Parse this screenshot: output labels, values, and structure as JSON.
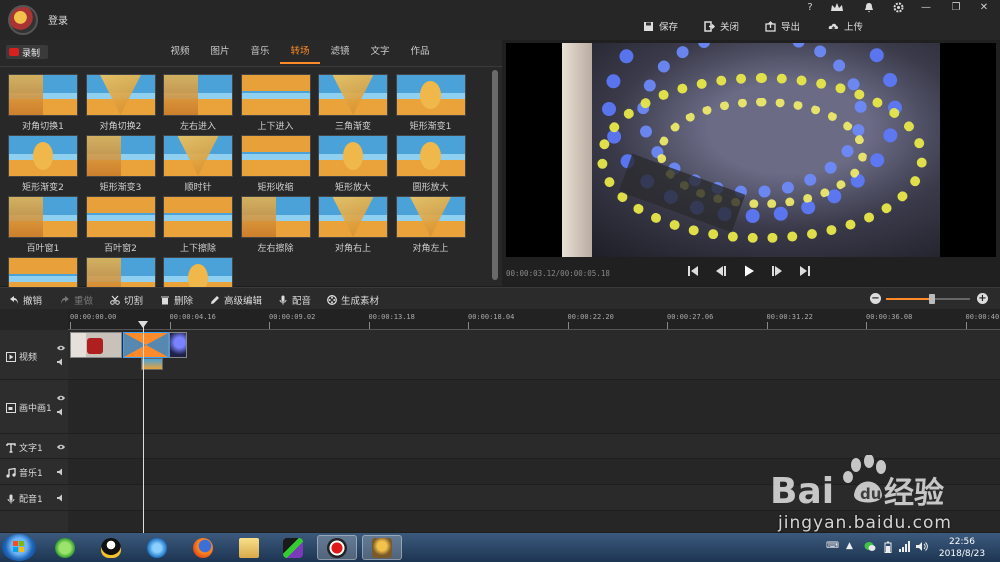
{
  "titlebar": {
    "login": "登录",
    "window_controls": [
      "?",
      "VIP",
      "bell-icon",
      "gear-icon",
      "—",
      "❐",
      "✕"
    ],
    "actions": {
      "save": "保存",
      "close": "关闭",
      "export": "导出",
      "upload": "上传"
    }
  },
  "library": {
    "record": "录制",
    "tabs": [
      "视频",
      "图片",
      "音乐",
      "转场",
      "滤镜",
      "文字",
      "作品"
    ],
    "active_tab": "转场",
    "transitions": [
      "对角切换1",
      "对角切换2",
      "左右进入",
      "上下进入",
      "三角渐变",
      "矩形渐变1",
      "矩形渐变2",
      "矩形渐变3",
      "顺时针",
      "矩形收缩",
      "矩形放大",
      "圆形放大",
      "百叶窗1",
      "百叶窗2",
      "上下擦除",
      "左右擦除",
      "对角右上",
      "对角左上",
      "",
      "",
      ""
    ]
  },
  "preview": {
    "time": "00:00:03.12/00:00:05.18"
  },
  "toolbar": {
    "undo": "撤销",
    "redo": "重做",
    "cut": "切割",
    "delete": "删除",
    "advanced_edit": "高级编辑",
    "dub": "配音",
    "generate": "生成素材",
    "zoom_level": 0.55
  },
  "timeline": {
    "ruler": [
      "00:00:00.00",
      "00:00:04.16",
      "00:00:09.02",
      "00:00:13.18",
      "00:00:18.04",
      "00:00:22.20",
      "00:00:27.06",
      "00:00:31.22",
      "00:00:36.08",
      "00:00:40"
    ],
    "tracks": {
      "video": "视频",
      "pip": "画中画1",
      "text": "文字1",
      "music": "音乐1",
      "voice": "配音1"
    }
  },
  "taskbar": {
    "clock_time": "22:56",
    "clock_date": "2018/8/23"
  },
  "watermark": {
    "text": "jingyan.baidu.com"
  },
  "colors": {
    "accent": "#ff8a2a",
    "record": "#d92020"
  }
}
